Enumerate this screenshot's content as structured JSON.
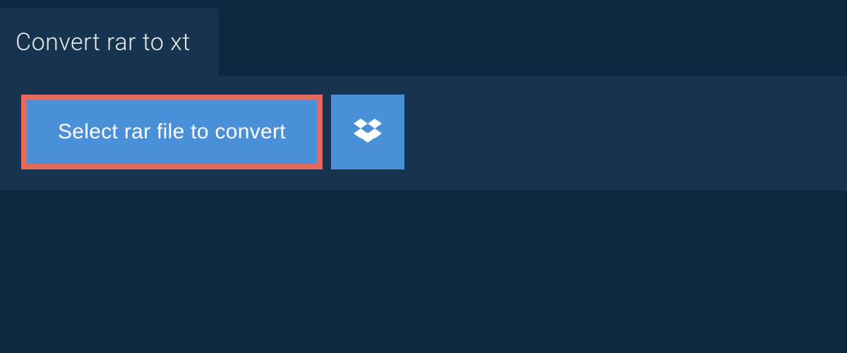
{
  "header": {
    "title": "Convert rar to xt"
  },
  "actions": {
    "select_file_label": "Select rar file to convert",
    "dropbox_icon": "dropbox-icon"
  }
}
